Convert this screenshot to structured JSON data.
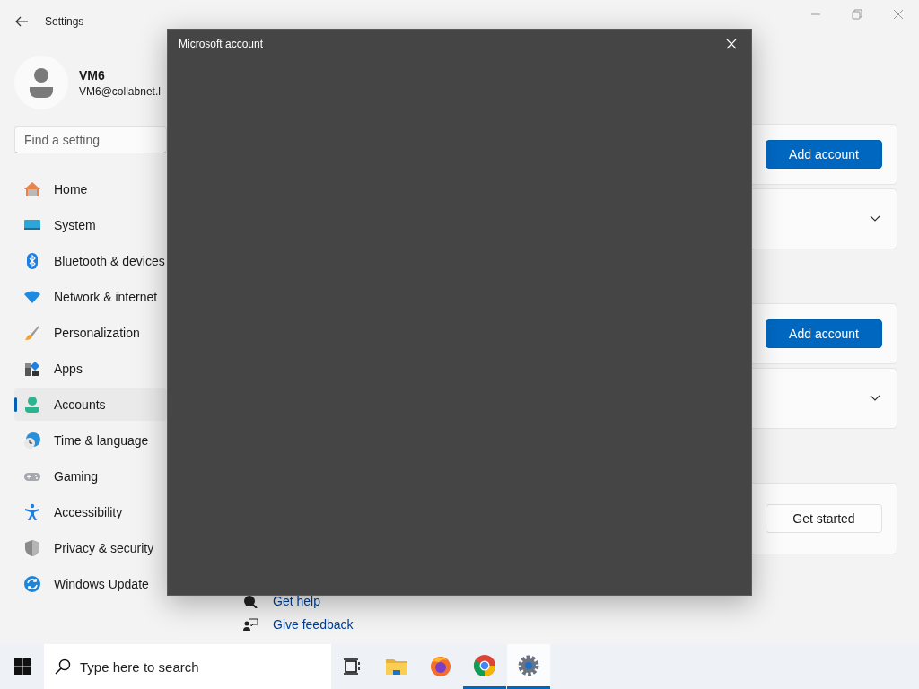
{
  "window": {
    "title": "Settings"
  },
  "user": {
    "name": "VM6",
    "email": "VM6@collabnet.l"
  },
  "search": {
    "placeholder": "Find a setting"
  },
  "nav": [
    {
      "label": "Home",
      "selected": false
    },
    {
      "label": "System",
      "selected": false
    },
    {
      "label": "Bluetooth & devices",
      "selected": false
    },
    {
      "label": "Network & internet",
      "selected": false
    },
    {
      "label": "Personalization",
      "selected": false
    },
    {
      "label": "Apps",
      "selected": false
    },
    {
      "label": "Accounts",
      "selected": true
    },
    {
      "label": "Time & language",
      "selected": false
    },
    {
      "label": "Gaming",
      "selected": false
    },
    {
      "label": "Accessibility",
      "selected": false
    },
    {
      "label": "Privacy & security",
      "selected": false
    },
    {
      "label": "Windows Update",
      "selected": false
    }
  ],
  "sections": [
    {
      "cards": [
        {
          "kind": "button",
          "button": "Add account",
          "primary": true
        },
        {
          "kind": "expander",
          "expanded": false
        }
      ]
    },
    {
      "cards": [
        {
          "kind": "button",
          "button": "Add account",
          "primary": true
        },
        {
          "kind": "expander",
          "expanded": false
        }
      ]
    },
    {
      "cards": [
        {
          "kind": "button",
          "button": "Get started",
          "primary": false
        }
      ]
    }
  ],
  "links": [
    {
      "kind": "help",
      "label": "Get help"
    },
    {
      "kind": "feedback",
      "label": "Give feedback"
    }
  ],
  "dialog": {
    "title": "Microsoft account"
  },
  "taskbar": {
    "search_placeholder": "Type here to search",
    "apps": [
      {
        "kind": "taskview",
        "running": false,
        "selected": false
      },
      {
        "kind": "folder",
        "running": false,
        "selected": false
      },
      {
        "kind": "firefox",
        "running": false,
        "selected": false
      },
      {
        "kind": "chrome",
        "running": true,
        "selected": false
      },
      {
        "kind": "settings",
        "running": true,
        "selected": true
      }
    ]
  }
}
